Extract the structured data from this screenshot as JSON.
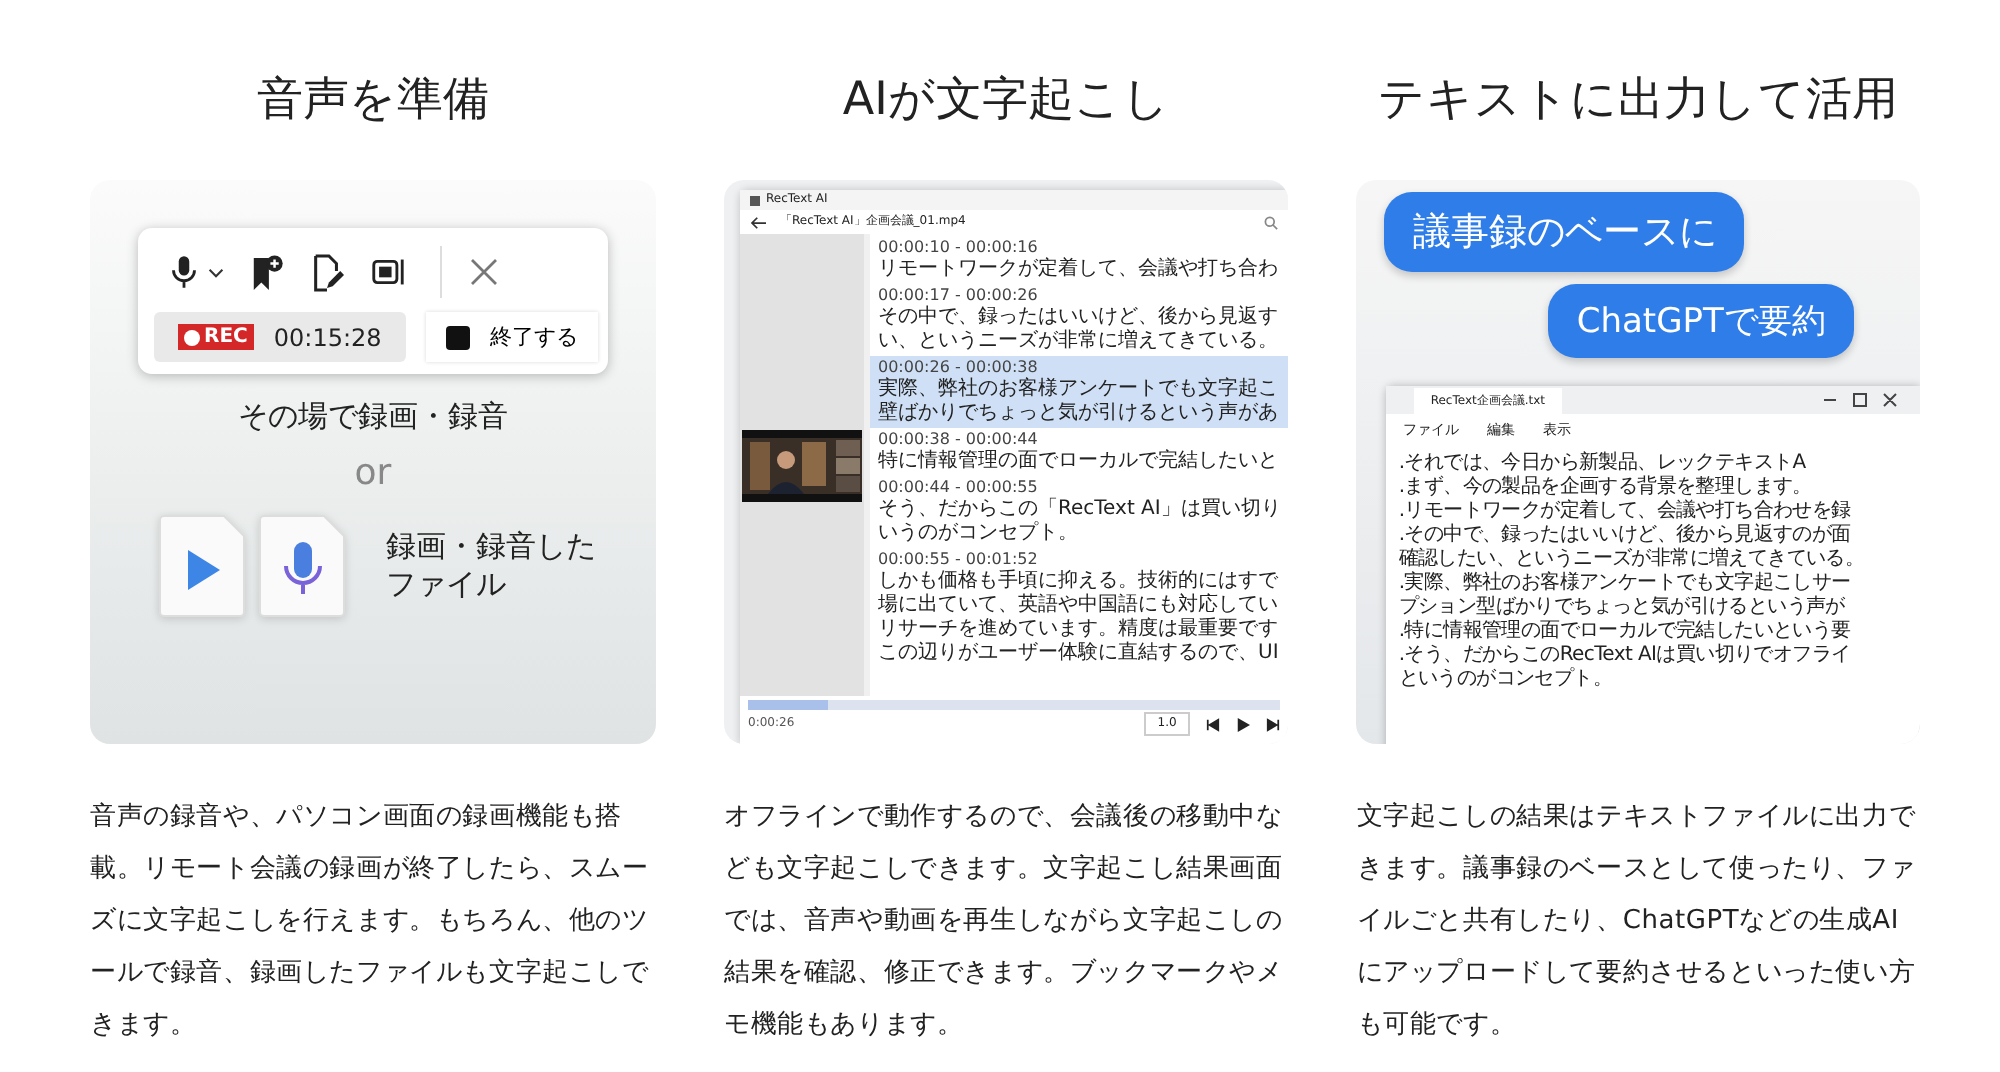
{
  "columns": [
    {
      "kind": "record",
      "heading": "音声を準備",
      "toolbar": {
        "rec_badge": "REC",
        "elapsed": "00:15:28",
        "stop_button": "終了する"
      },
      "caption": "その場で録画・録音",
      "or": "or",
      "file_caption": [
        "録画・録音した",
        "ファイル"
      ],
      "description": "音声の録音や、パソコン画面の録画機能も搭載。リモート会議の録画が終了したら、スムーズに文字起こしを行えます。もちろん、他のツールで録音、録画したファイルも文字起こしできます。"
    },
    {
      "kind": "transcript",
      "heading": "AIが文字起こし",
      "window": {
        "app_title": "RecText AI",
        "file_name": "「RecText AI」企画会議_01.mp4",
        "segments": [
          {
            "time": "00:00:10 - 00:00:16",
            "lines": [
              "リモートワークが定着して、会議や打ち合わ"
            ],
            "selected": false
          },
          {
            "time": "00:00:17 - 00:00:26",
            "lines": [
              "その中で、録ったはいいけど、後から見返す",
              "い、というニーズが非常に増えてきている。"
            ],
            "selected": false
          },
          {
            "time": "00:00:26 - 00:00:38",
            "lines": [
              "実際、弊社のお客様アンケートでも文字起こ",
              "壁ばかりでちょっと気が引けるという声があ"
            ],
            "selected": true
          },
          {
            "time": "00:00:38 - 00:00:44",
            "lines": [
              "特に情報管理の面でローカルで完結したいと"
            ],
            "selected": false
          },
          {
            "time": "00:00:44 - 00:00:55",
            "lines": [
              "そう、だからこの「RecText AI」は買い切り",
              "いうのがコンセプト。"
            ],
            "selected": false
          },
          {
            "time": "00:00:55 - 00:01:52",
            "lines": [
              "しかも価格も手頃に抑える。技術的にはすで",
              "場に出ていて、英語や中国語にも対応してい",
              "リサーチを進めています。精度は最重要です",
              "この辺りがユーザー体験に直結するので、UI"
            ],
            "selected": false
          }
        ],
        "elapsed": "0:00:26",
        "speed": "1.0"
      },
      "description": "オフラインで動作するので、会議後の移動中なども文字起こしできます。文字起こし結果画面では、音声や動画を再生しながら文字起こしの結果を確認、修正できます。ブックマークやメモ機能もあります。"
    },
    {
      "kind": "export",
      "heading": "テキストに出力して活用",
      "bubbles": [
        "議事録のベースに",
        "ChatGPTで要約"
      ],
      "notepad": {
        "tab": "RecText企画会議.txt",
        "menus": [
          "ファイル",
          "編集",
          "表示"
        ],
        "lines": [
          ".それでは、今日から新製品、レックテキストA",
          ".まず、今の製品を企画する背景を整理します。",
          ".リモートワークが定着して、会議や打ち合わせを録",
          ".その中で、録ったはいいけど、後から見返すのが面",
          "確認したい、というニーズが非常に増えてきている。",
          ".実際、弊社のお客様アンケートでも文字起こしサー",
          "プション型ばかりでちょっと気が引けるという声が",
          ".特に情報管理の面でローカルで完結したいという要",
          ".そう、だからこのRecText AIは買い切りでオフライ",
          "というのがコンセプト。"
        ]
      },
      "description": "文字起こしの結果はテキストファイルに出力できます。議事録のベースとして使ったり、ファイルごと共有したり、ChatGPTなどの生成AIにアップロードして要約させるといった使い方も可能です。"
    }
  ]
}
